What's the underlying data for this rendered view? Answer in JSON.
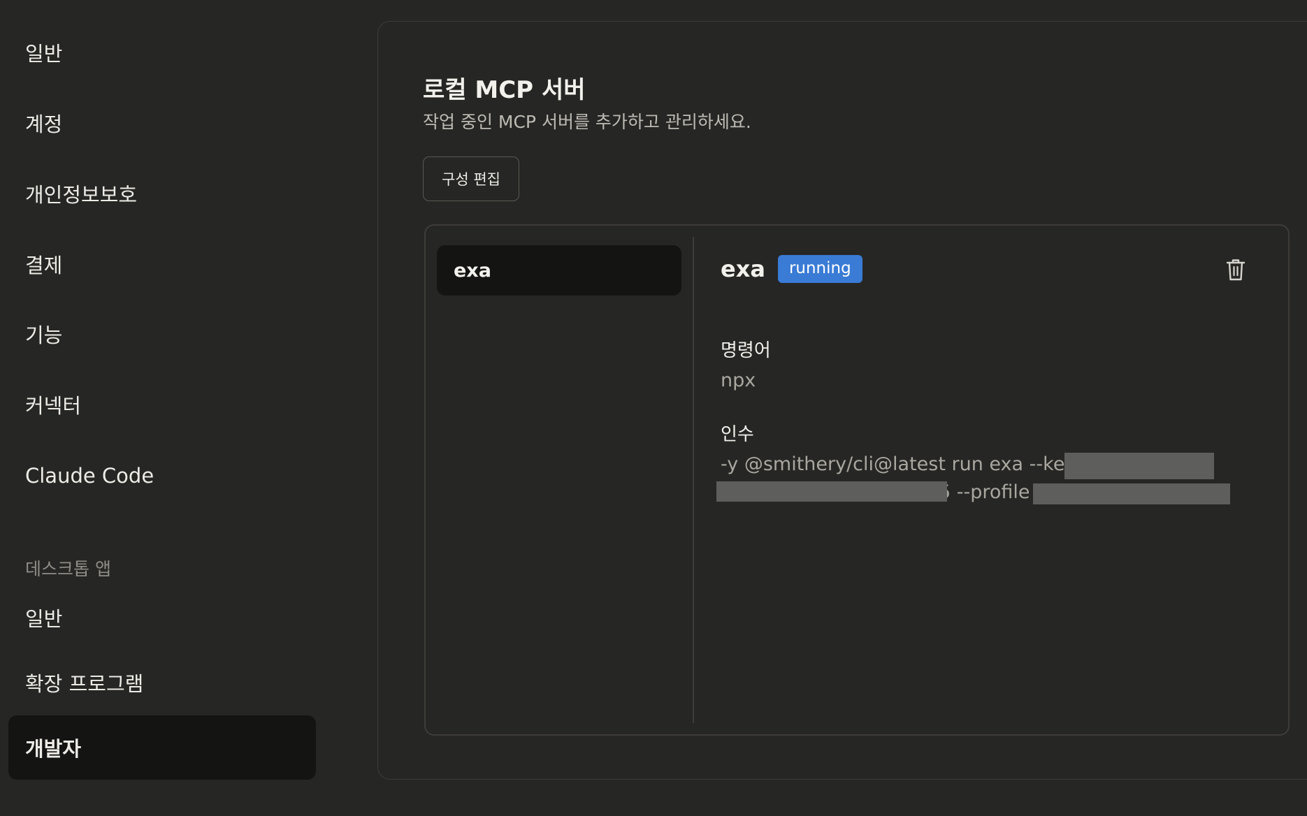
{
  "sidebar": {
    "items": [
      {
        "label": "일반"
      },
      {
        "label": "계정"
      },
      {
        "label": "개인정보보호"
      },
      {
        "label": "결제"
      },
      {
        "label": "기능"
      },
      {
        "label": "커넥터"
      },
      {
        "label": "Claude Code"
      }
    ],
    "desktop_section_title": "데스크톱 앱",
    "desktop_items": [
      {
        "label": "일반"
      },
      {
        "label": "확장 프로그램"
      },
      {
        "label": "개발자",
        "active": true
      }
    ]
  },
  "main": {
    "title": "로컬 MCP 서버",
    "subtitle": "작업 중인 MCP 서버를 추가하고 관리하세요.",
    "edit_button_label": "구성 편집",
    "servers": [
      {
        "name": "exa"
      }
    ],
    "selected_server": {
      "name": "exa",
      "status": "running",
      "command_label": "명령어",
      "command": "npx",
      "args_label": "인수",
      "args_line1": "-y @smithery/cli@latest run exa --key",
      "args_line2_tail": "5 --profile"
    }
  },
  "colors": {
    "background": "#262624",
    "active_item": "#141413",
    "status_running": "#3a7bd5",
    "redaction": "#5e5e5c"
  },
  "icons": {
    "delete": "trash-icon"
  }
}
